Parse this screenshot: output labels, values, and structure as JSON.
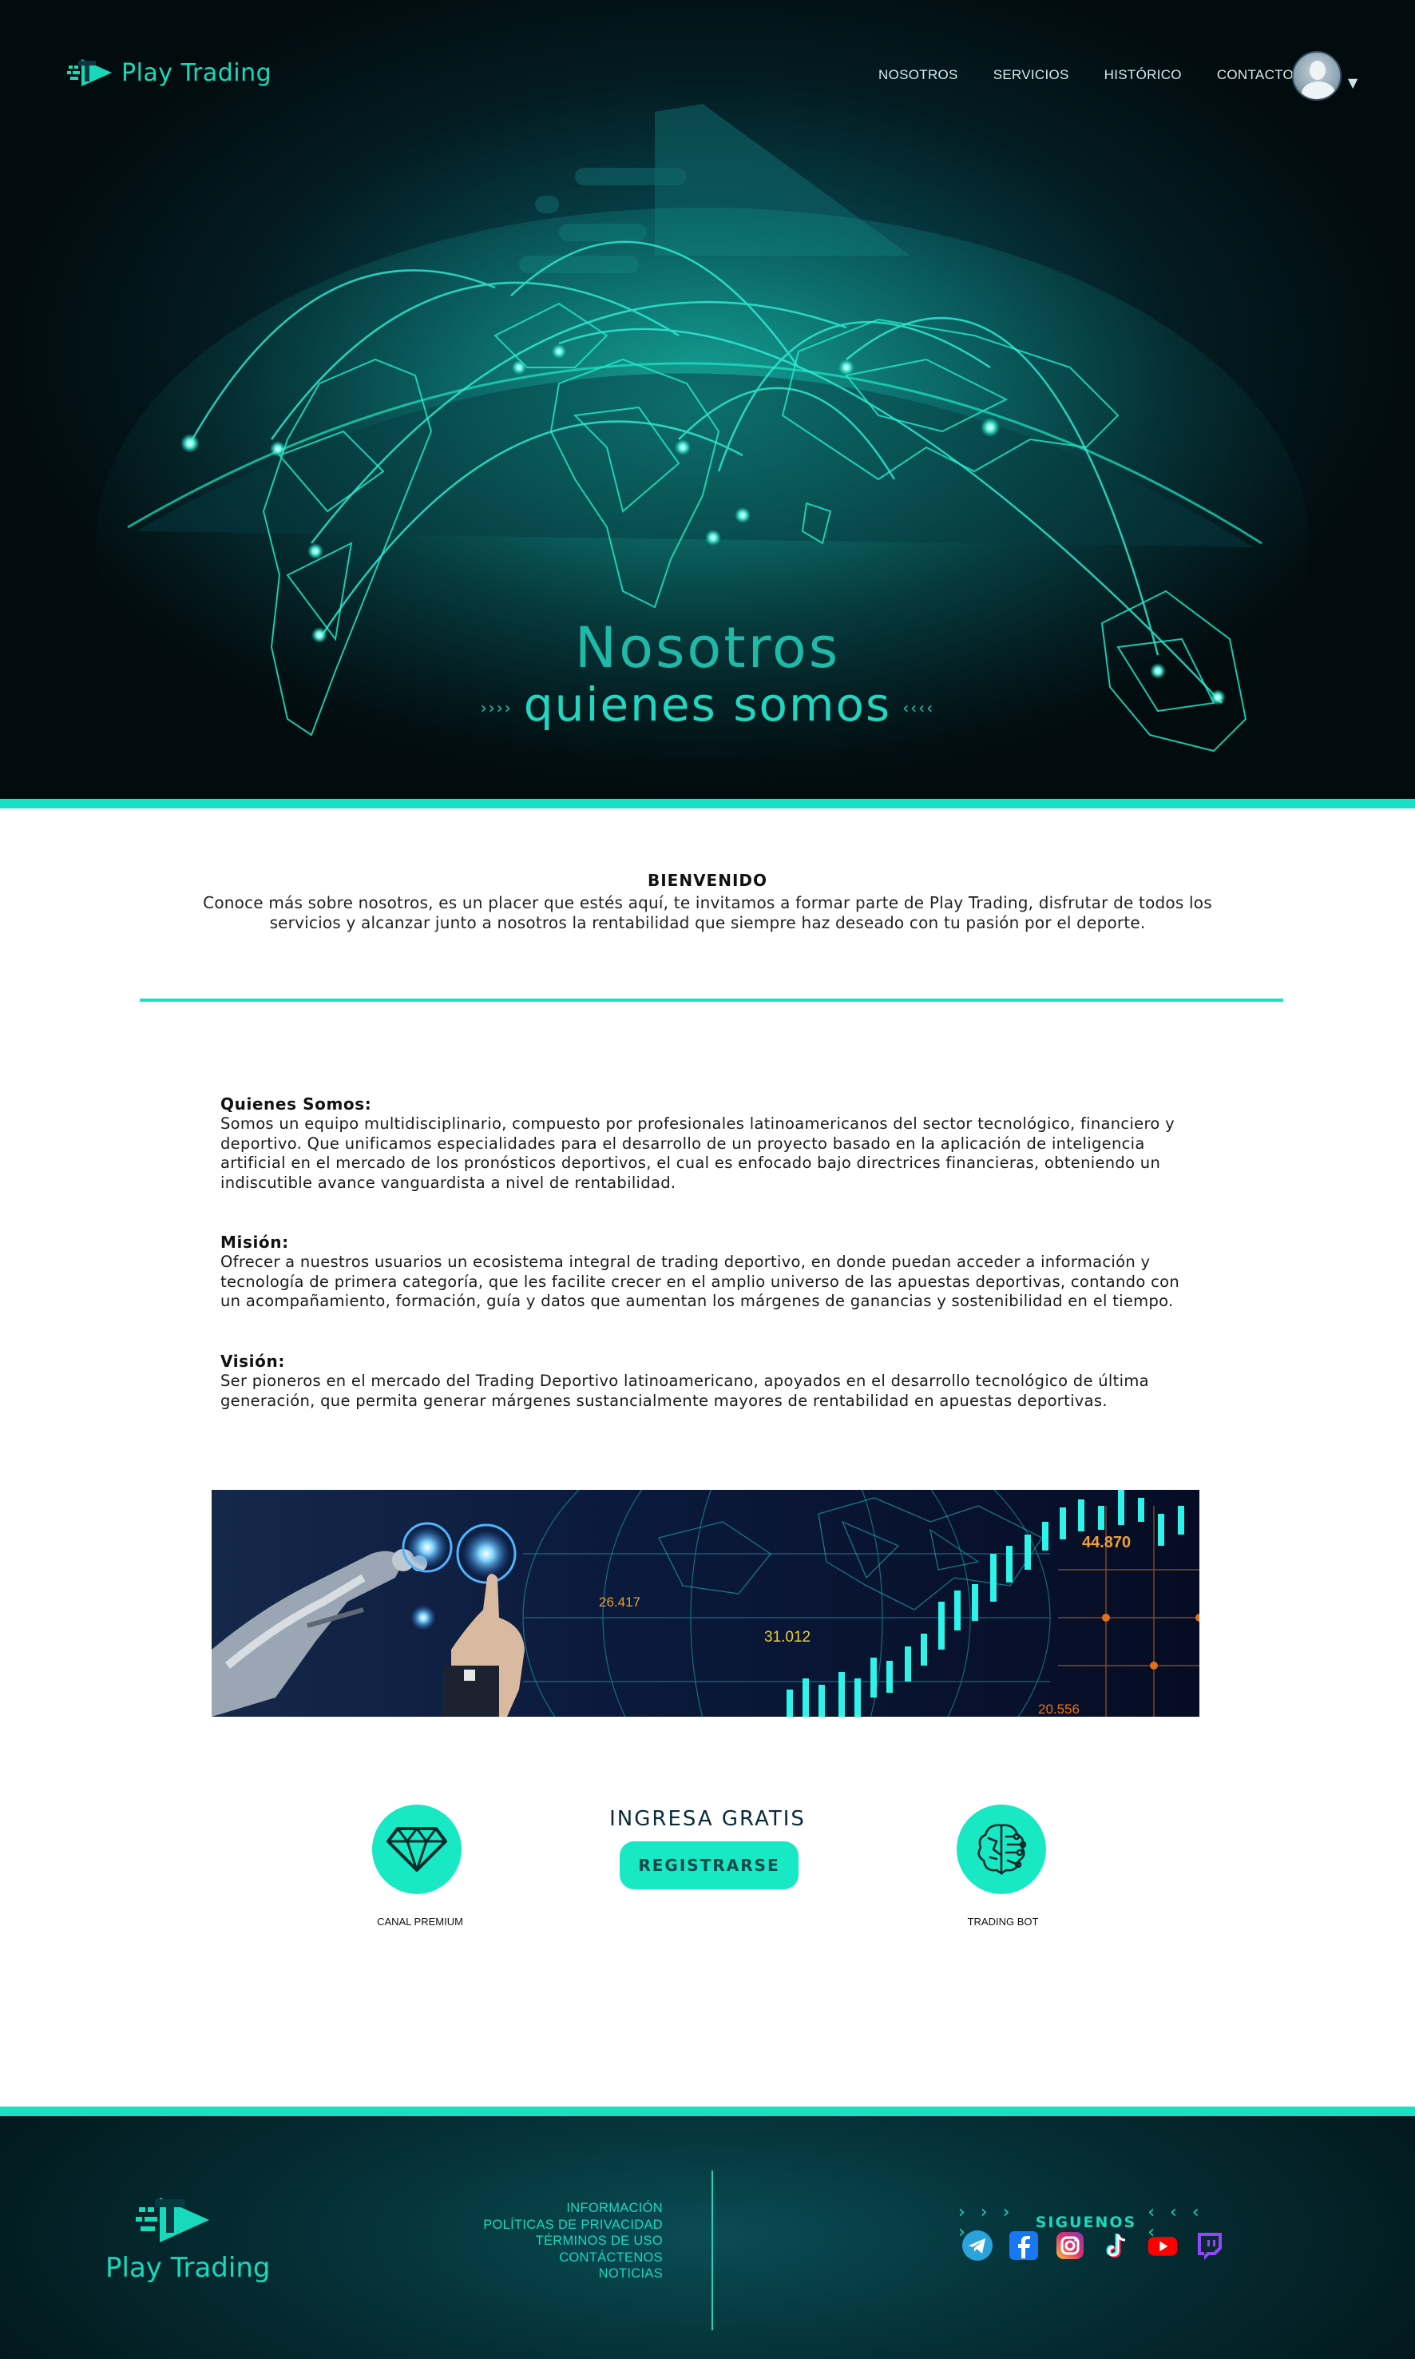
{
  "header": {
    "brand": "Play Trading",
    "nav": [
      {
        "label": "NOSOTROS"
      },
      {
        "label": "SERVICIOS"
      },
      {
        "label": "HISTÓRICO"
      },
      {
        "label": "CONTACTO"
      }
    ]
  },
  "hero": {
    "title": "Nosotros",
    "subtitle": "quienes somos",
    "left_arrows": "››››",
    "right_arrows": "‹‹‹‹"
  },
  "welcome": {
    "heading": "BIENVENIDO",
    "text": "Conoce más sobre nosotros, es un placer que estés aquí, te invitamos a formar parte de Play Trading, disfrutar de todos los servicios y alcanzar junto a nosotros la rentabilidad que siempre haz deseado con tu pasión por el deporte."
  },
  "about": {
    "who_title": "Quienes Somos:",
    "who_text": "Somos un equipo multidisciplinario, compuesto por profesionales latinoamericanos del sector tecnológico, financiero y deportivo. Que unificamos especialidades para el desarrollo de un proyecto basado en la aplicación de inteligencia artificial en el mercado de los pronósticos  deportivos, el cual es enfocado bajo directrices financieras, obteniendo un indiscutible avance vanguardista a nivel de rentabilidad.",
    "mission_title": "Misión:",
    "mission_text": "Ofrecer a nuestros usuarios un ecosistema integral de trading deportivo, en donde puedan acceder a información y tecnología de primera categoría, que les facilite crecer en el amplio universo de las apuestas deportivas, contando con un acompañamiento, formación, guía y datos que aumentan los márgenes de ganancias y sostenibilidad en el tiempo.",
    "vision_title": "Visión:",
    "vision_text": "Ser pioneros en el mercado del Trading Deportivo latinoamericano, apoyados en el desarrollo tecnológico de última generación, que permita generar márgenes sustancialmente mayores de rentabilidad en apuestas deportivas."
  },
  "banner": {
    "numbers": [
      "26.417",
      "31.012",
      "44.870",
      "20.556"
    ]
  },
  "cta": {
    "premium_label": "CANAL PREMIUM",
    "ingresa": "INGRESA GRATIS",
    "register_label": "REGISTRARSE",
    "bot_label": "TRADING BOT"
  },
  "footer": {
    "brand": "Play Trading",
    "links": [
      {
        "label": "INFORMACIÓN"
      },
      {
        "label": "POLÍTICAS DE PRIVACIDAD"
      },
      {
        "label": "TÉRMINOS DE USO"
      },
      {
        "label": "CONTÁCTENOS"
      },
      {
        "label": "NOTICIAS"
      }
    ],
    "follow_label": "SIGUENOS",
    "follow_left": "› › › ›",
    "follow_right": "‹ ‹ ‹ ‹",
    "social": [
      "telegram-icon",
      "facebook-icon",
      "instagram-icon",
      "tiktok-icon",
      "youtube-icon",
      "twitch-icon"
    ]
  },
  "colors": {
    "accent": "#19e0c4",
    "hero_dark": "#020b0e",
    "text_teal": "#1fb9a8"
  }
}
